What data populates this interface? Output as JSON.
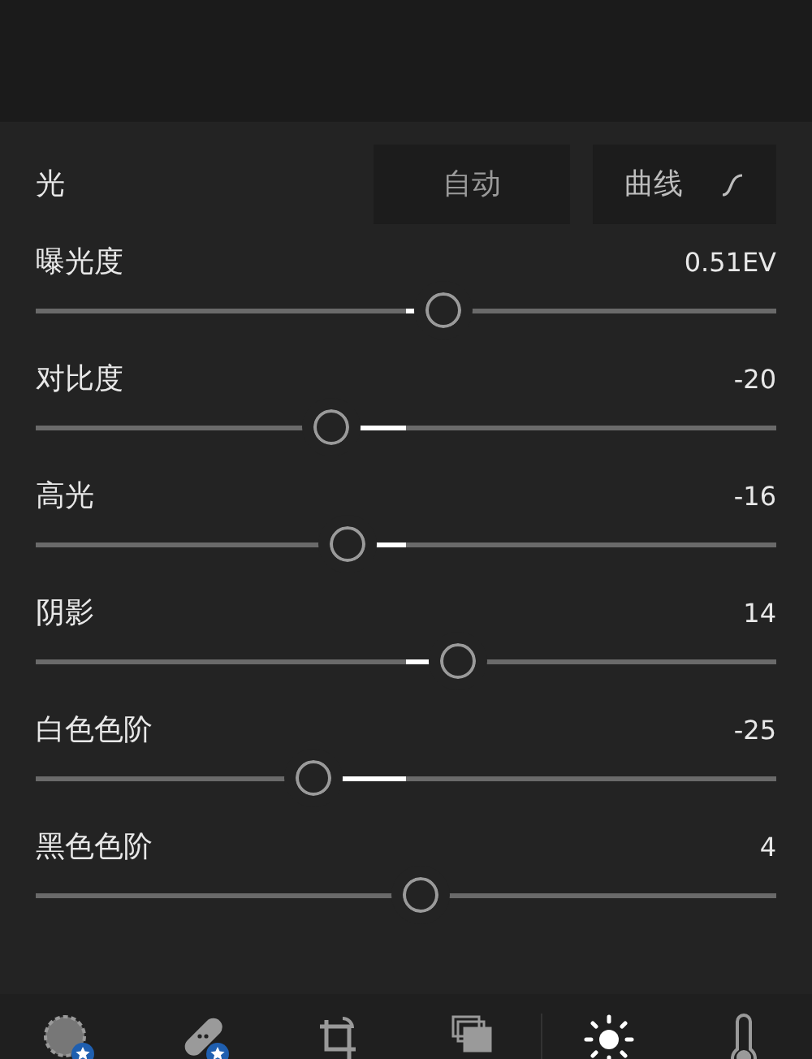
{
  "section": {
    "title": "光",
    "auto_button": "自动",
    "curve_button": "曲线"
  },
  "sliders": [
    {
      "label": "曝光度",
      "reading": "0.51EV",
      "level": 0.55
    },
    {
      "label": "对比度",
      "reading": "-20",
      "level": 0.4
    },
    {
      "label": "高光",
      "reading": "-16",
      "level": 0.42
    },
    {
      "label": "阴影",
      "reading": "14",
      "level": 0.57
    },
    {
      "label": "白色色阶",
      "reading": "-25",
      "level": 0.375
    },
    {
      "label": "黑色色阶",
      "reading": "4",
      "level": 0.52
    }
  ],
  "toolbar": [
    {
      "kind": "selective",
      "selected": false
    },
    {
      "kind": "healing",
      "selected": false
    },
    {
      "kind": "crop",
      "selected": false
    },
    {
      "kind": "presets",
      "selected": false
    },
    {
      "kind": "light",
      "selected": true
    },
    {
      "kind": "color",
      "selected": false
    }
  ]
}
